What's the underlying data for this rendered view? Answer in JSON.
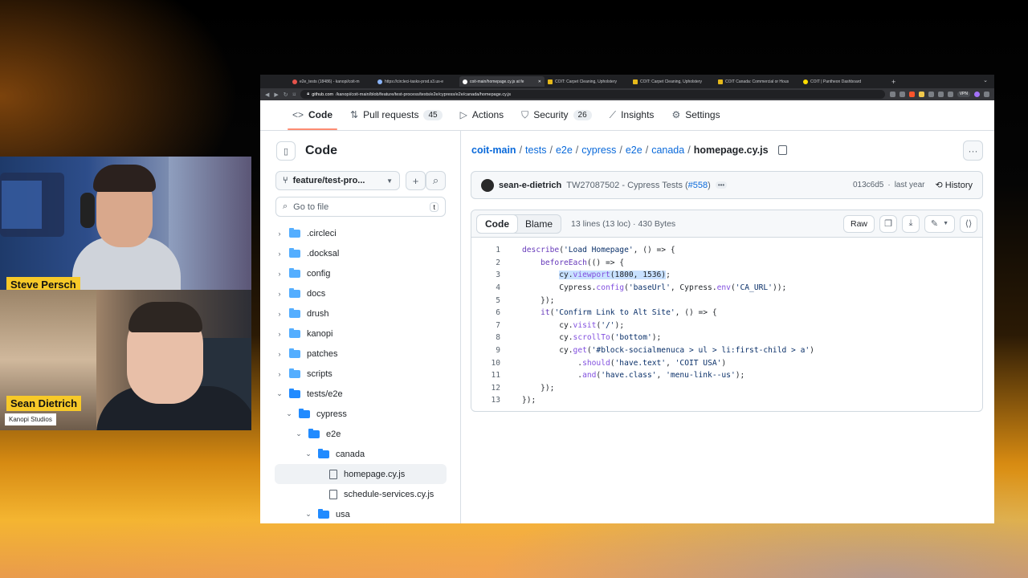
{
  "cams": {
    "person1": "Steve Persch",
    "person2": "Sean Dietrich",
    "org": "Kanopi Studios"
  },
  "browser": {
    "tabs": [
      "e2e_tests (18486) - kanopi/coit-m",
      "https://circleci-tasks-prod.s3.us-e",
      "coit-main/homepage.cy.js at fe",
      "COIT: Carpet Cleaning, Upholstery",
      "COIT: Carpet Cleaning, Upholstery",
      "COIT Canada: Commercial or Hous",
      "COIT | Pantheon Dashboard"
    ],
    "active_tab": 2,
    "url_host": "github.com",
    "url_path": "/kanopi/coit-main/blob/feature/test-process/tests/e2e/cypress/e2e/canada/homepage.cy.js",
    "vpn_label": "VPN"
  },
  "repo_nav": [
    {
      "label": "Code",
      "icon": "code-icon",
      "count": ""
    },
    {
      "label": "Pull requests",
      "icon": "pull-request-icon",
      "count": "45"
    },
    {
      "label": "Actions",
      "icon": "play-icon",
      "count": ""
    },
    {
      "label": "Security",
      "icon": "shield-icon",
      "count": "26"
    },
    {
      "label": "Insights",
      "icon": "graph-icon",
      "count": ""
    },
    {
      "label": "Settings",
      "icon": "gear-icon",
      "count": ""
    }
  ],
  "sidebar": {
    "title": "Code",
    "branch": "feature/test-pro...",
    "goto_placeholder": "Go to file",
    "goto_shortcut": "t",
    "tree": [
      {
        "name": ".circleci",
        "type": "folder",
        "depth": 0,
        "open": false
      },
      {
        "name": ".docksal",
        "type": "folder",
        "depth": 0,
        "open": false
      },
      {
        "name": "config",
        "type": "folder",
        "depth": 0,
        "open": false
      },
      {
        "name": "docs",
        "type": "folder",
        "depth": 0,
        "open": false
      },
      {
        "name": "drush",
        "type": "folder",
        "depth": 0,
        "open": false
      },
      {
        "name": "kanopi",
        "type": "folder",
        "depth": 0,
        "open": false
      },
      {
        "name": "patches",
        "type": "folder",
        "depth": 0,
        "open": false
      },
      {
        "name": "scripts",
        "type": "folder",
        "depth": 0,
        "open": false
      },
      {
        "name": "tests/e2e",
        "type": "folder",
        "depth": 0,
        "open": true
      },
      {
        "name": "cypress",
        "type": "folder",
        "depth": 1,
        "open": true
      },
      {
        "name": "e2e",
        "type": "folder",
        "depth": 2,
        "open": true
      },
      {
        "name": "canada",
        "type": "folder",
        "depth": 3,
        "open": true
      },
      {
        "name": "homepage.cy.js",
        "type": "file",
        "depth": 4,
        "current": true
      },
      {
        "name": "schedule-services.cy.js",
        "type": "file",
        "depth": 4
      },
      {
        "name": "usa",
        "type": "folder",
        "depth": 3,
        "open": true
      }
    ]
  },
  "breadcrumb": [
    "coit-main",
    "tests",
    "e2e",
    "cypress",
    "e2e",
    "canada",
    "homepage.cy.js"
  ],
  "commit": {
    "author": "sean-e-dietrich",
    "message": "TW27087502 - Cypress Tests (",
    "pr": "#558",
    "message_end": ")",
    "sha": "013c6d5",
    "when": "last year",
    "history": "History"
  },
  "file": {
    "tab_code": "Code",
    "tab_blame": "Blame",
    "meta": "13 lines (13 loc) · 430 Bytes",
    "raw": "Raw"
  },
  "code_lines": [
    "describe('Load Homepage', () => {",
    "    beforeEach(() => {",
    "        cy.viewport(1800, 1536);",
    "        Cypress.config('baseUrl', Cypress.env('CA_URL'));",
    "    });",
    "    it('Confirm Link to Alt Site', () => {",
    "        cy.visit('/');",
    "        cy.scrollTo('bottom');",
    "        cy.get('#block-socialmenuca > ul > li:first-child > a')",
    "            .should('have.text', 'COIT USA')",
    "            .and('have.class', 'menu-link--us');",
    "    });",
    "});"
  ],
  "line_numbers": [
    "1",
    "2",
    "3",
    "4",
    "5",
    "6",
    "7",
    "8",
    "9",
    "10",
    "11",
    "12",
    "13"
  ]
}
